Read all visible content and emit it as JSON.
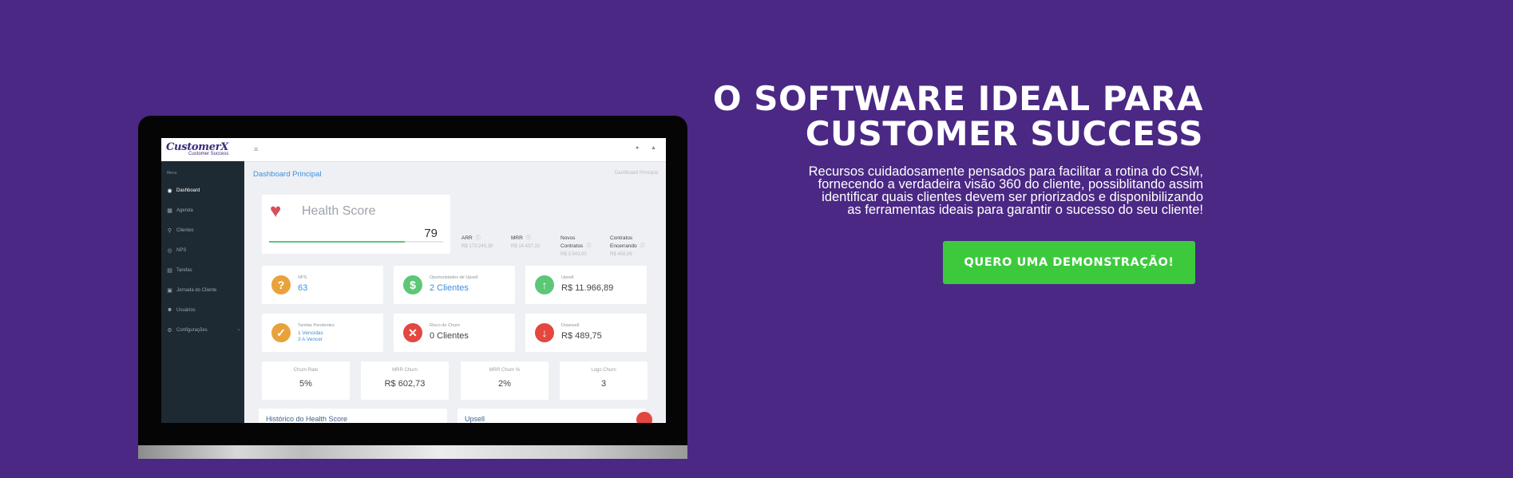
{
  "hero": {
    "headline_line1": "O SOFTWARE IDEAL PARA",
    "headline_line2": "CUSTOMER SUCCESS",
    "description_line1": "Recursos cuidadosamente pensados para facilitar a rotina do CSM,",
    "description_line2": "fornecendo a verdadeira visão 360 do cliente, possiblitando assim",
    "description_line3": "identificar quais clientes devem ser priorizados e disponibilizando",
    "description_line4": "as ferramentas ideais para garantir o sucesso do seu cliente!",
    "cta_label": "QUERO UMA DEMONSTRAÇÃO!",
    "colors": {
      "background": "#4a2884",
      "cta": "#3cca3c"
    }
  },
  "dashboard": {
    "logo_main": "CustomerX",
    "logo_sub": "Customer Success",
    "sidebar": {
      "title": "Menu",
      "items": [
        {
          "label": "Dashboard",
          "icon": "dashboard-icon"
        },
        {
          "label": "Agenda",
          "icon": "calendar-icon"
        },
        {
          "label": "Clientes",
          "icon": "search-icon"
        },
        {
          "label": "NPS",
          "icon": "target-icon"
        },
        {
          "label": "Tarefas",
          "icon": "tasks-icon"
        },
        {
          "label": "Jornada do Cliente",
          "icon": "journey-icon"
        },
        {
          "label": "Usuários",
          "icon": "users-icon"
        },
        {
          "label": "Configurações",
          "icon": "gear-icon"
        }
      ]
    },
    "page_title": "Dashboard Principal",
    "breadcrumb": "Dashboard Principal",
    "health_score": {
      "title": "Health Score",
      "value": "79",
      "progress": 0.78
    },
    "metrics": [
      {
        "label": "ARR",
        "value": "R$ 173.245,30"
      },
      {
        "label": "MRR",
        "value": "R$ 14.437,10"
      },
      {
        "label": "Novos Contratos",
        "value": "R$ 3.543,00"
      },
      {
        "label": "Contratos Encerrando",
        "value": "R$ 458,99"
      }
    ],
    "kpis": [
      {
        "label": "NPS",
        "value": "63",
        "icon": "question-icon",
        "color": "#e9a23b"
      },
      {
        "label": "Oportunidades de Upsell",
        "value": "2 Clientes",
        "icon": "dollar-icon",
        "color": "#5cc777"
      },
      {
        "label": "Upsell",
        "value": "R$ 11.966,89",
        "icon": "arrow-up-icon",
        "color": "#5cc777"
      },
      {
        "label": "Tarefas Pendentes",
        "value": "1 Vencidas",
        "value2": "3 A Vencer",
        "icon": "check-icon",
        "color": "#e9a23b"
      },
      {
        "label": "Risco de Churn",
        "value": "0 Clientes",
        "icon": "close-icon",
        "color": "#e4473f"
      },
      {
        "label": "Downsell",
        "value": "R$ 489,75",
        "icon": "arrow-down-icon",
        "color": "#e4473f"
      }
    ],
    "stats": [
      {
        "label": "Churn Rate",
        "value": "5%"
      },
      {
        "label": "MRR Churn",
        "value": "R$ 602,73"
      },
      {
        "label": "MRR Churn %",
        "value": "2%"
      },
      {
        "label": "Logo Churn",
        "value": "3"
      }
    ],
    "bottom_cards": [
      {
        "label": "Histórico do Health Score"
      },
      {
        "label": "Upsell"
      }
    ]
  }
}
